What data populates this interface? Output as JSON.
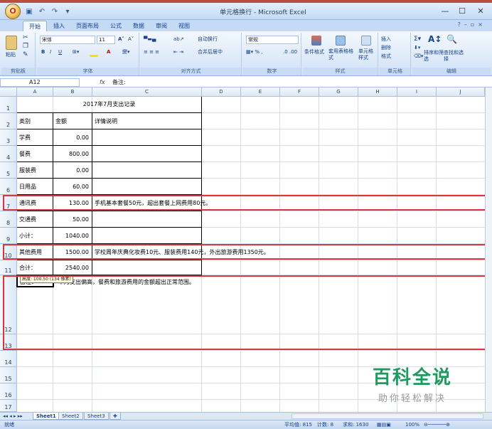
{
  "window": {
    "title": "单元格换行 - Microsoft Excel",
    "office_button": "Office"
  },
  "quick_access": [
    "save-icon",
    "undo-icon",
    "redo-icon",
    "customize-icon"
  ],
  "tabs": [
    "开始",
    "插入",
    "页面布局",
    "公式",
    "数据",
    "审阅",
    "视图"
  ],
  "active_tab": "开始",
  "ribbon": {
    "clipboard": {
      "label": "剪贴板",
      "paste": "粘贴"
    },
    "font": {
      "label": "字体",
      "name": "宋体",
      "size": "11"
    },
    "alignment": {
      "label": "对齐方式",
      "wrap": "自动换行",
      "merge": "合并后居中"
    },
    "number": {
      "label": "数字",
      "format": "常规"
    },
    "styles": {
      "label": "样式",
      "conditional": "条件格式",
      "table": "套用表格格式",
      "cell_styles": "单元格样式"
    },
    "cells": {
      "label": "单元格",
      "insert": "插入",
      "delete": "删除",
      "format": "格式"
    },
    "editing": {
      "label": "编辑",
      "sort": "排序和筛选",
      "find": "查找和选择"
    }
  },
  "formula_bar": {
    "name_box": "A12",
    "fx": "fx",
    "content": "备注:"
  },
  "columns": [
    "A",
    "B",
    "C",
    "D",
    "E",
    "F",
    "G",
    "H",
    "I",
    "J"
  ],
  "rows": [
    "1",
    "2",
    "3",
    "4",
    "5",
    "6",
    "7",
    "8",
    "9",
    "10",
    "11",
    "12",
    "13",
    "14",
    "15",
    "16",
    "17"
  ],
  "sheet": {
    "title": "2017年7月支出记录",
    "headers": {
      "category": "类别",
      "amount": "金额",
      "detail": "详情说明"
    },
    "records": [
      {
        "category": "学费",
        "amount": "0.00",
        "detail": ""
      },
      {
        "category": "餐费",
        "amount": "800.00",
        "detail": ""
      },
      {
        "category": "服装费",
        "amount": "0.00",
        "detail": ""
      },
      {
        "category": "日用品",
        "amount": "60.00",
        "detail": ""
      },
      {
        "category": "通讯费",
        "amount": "130.00",
        "detail": "手机基本套餐50元，超出套餐上网费用80元。"
      },
      {
        "category": "交通费",
        "amount": "50.00",
        "detail": ""
      },
      {
        "category": "小计：",
        "amount": "1040.00",
        "detail": ""
      },
      {
        "category": "其他费用",
        "amount": "1500.00",
        "detail": "学校周年庆典化妆费10元、服装费用140元，外出旅游费用1350元。"
      },
      {
        "category": "合计：",
        "amount": "2540.00",
        "detail": ""
      }
    ],
    "remark_label": "备注：",
    "remark_text": "本月支出偏高，餐费和旅游费用的金额超出正常范围。",
    "tooltip": "高度: 100.50 (134 像素)"
  },
  "sheet_tabs": [
    "Sheet1",
    "Sheet2",
    "Sheet3"
  ],
  "status": {
    "ready": "就绪",
    "average": "平均值: 815",
    "count": "计数: 8",
    "sum": "求和: 1630",
    "zoom": "100%"
  },
  "watermark": {
    "title": "百科全说",
    "subtitle": "助你轻松解决"
  },
  "colors": {
    "highlight": "#d9383a",
    "accent": "#15428b",
    "watermark": "#1d9b5e"
  }
}
